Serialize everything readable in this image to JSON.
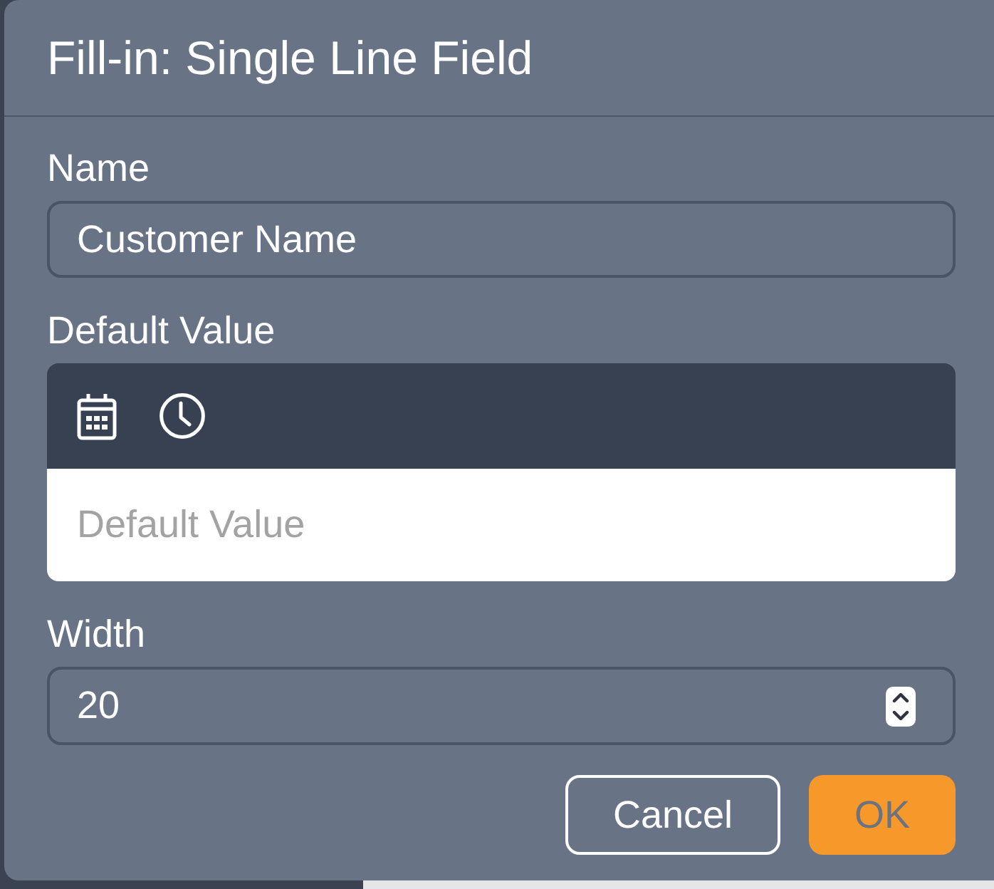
{
  "dialog": {
    "title": "Fill-in: Single Line Field",
    "fields": [
      {
        "kind": "text",
        "label": "Name",
        "value": "Customer Name"
      },
      {
        "kind": "editor",
        "label": "Default Value",
        "placeholder": "Default Value"
      },
      {
        "kind": "number",
        "label": "Width",
        "value": "20"
      }
    ],
    "buttons": [
      {
        "kind": "secondary",
        "label": "Cancel"
      },
      {
        "kind": "primary",
        "label": "OK"
      }
    ]
  }
}
